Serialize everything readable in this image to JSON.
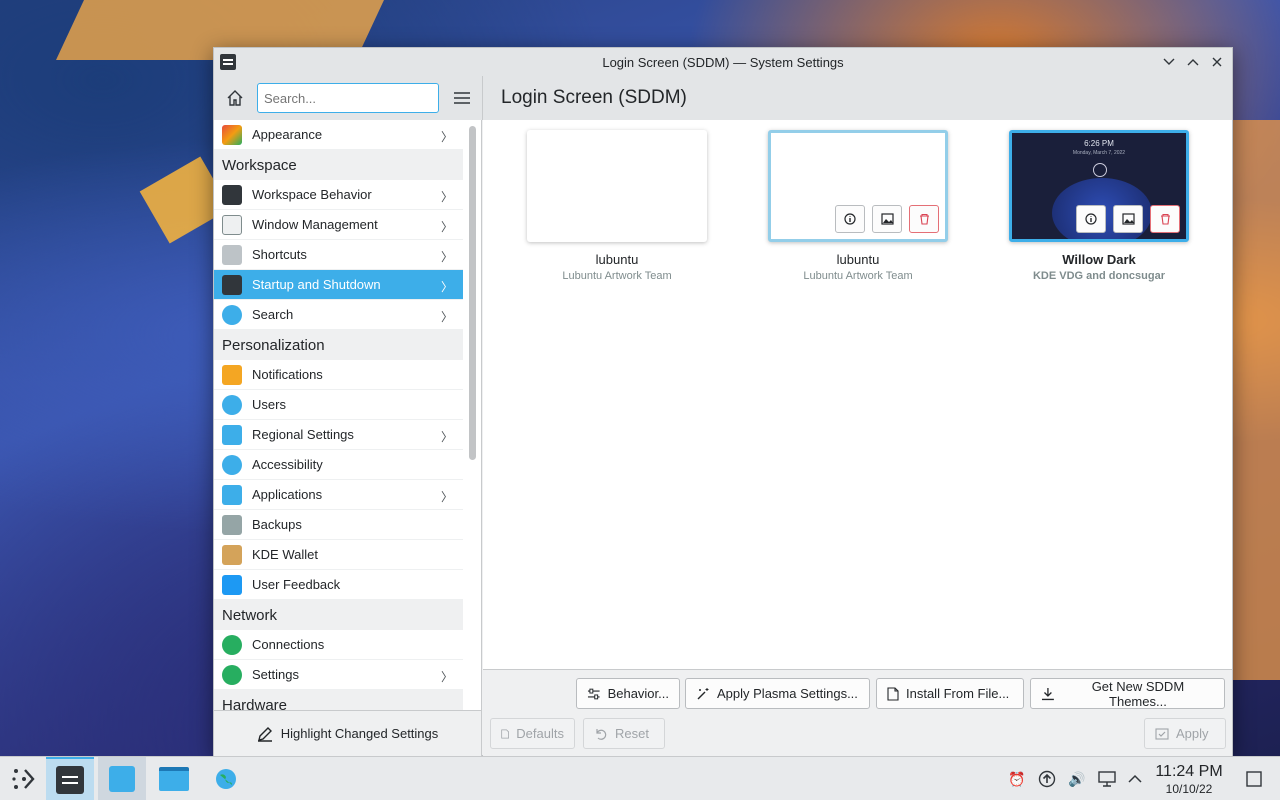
{
  "window": {
    "title": "Login Screen (SDDM) — System Settings"
  },
  "search": {
    "placeholder": "Search..."
  },
  "page_title": "Login Screen (SDDM)",
  "sidebar": {
    "top_item": {
      "label": "Appearance",
      "icon": "appearance-icon"
    },
    "sections": [
      {
        "title": "Workspace",
        "items": [
          {
            "label": "Workspace Behavior",
            "icon": "workspace-behavior-icon",
            "chevron": true
          },
          {
            "label": "Window Management",
            "icon": "window-management-icon",
            "chevron": true
          },
          {
            "label": "Shortcuts",
            "icon": "keyboard-icon",
            "chevron": true
          },
          {
            "label": "Startup and Shutdown",
            "icon": "startup-icon",
            "chevron": true,
            "selected": true
          },
          {
            "label": "Search",
            "icon": "search-icon",
            "chevron": true
          }
        ]
      },
      {
        "title": "Personalization",
        "items": [
          {
            "label": "Notifications",
            "icon": "bell-icon"
          },
          {
            "label": "Users",
            "icon": "users-icon"
          },
          {
            "label": "Regional Settings",
            "icon": "regional-icon",
            "chevron": true
          },
          {
            "label": "Accessibility",
            "icon": "accessibility-icon"
          },
          {
            "label": "Applications",
            "icon": "applications-icon",
            "chevron": true
          },
          {
            "label": "Backups",
            "icon": "backups-icon"
          },
          {
            "label": "KDE Wallet",
            "icon": "wallet-icon"
          },
          {
            "label": "User Feedback",
            "icon": "feedback-icon"
          }
        ]
      },
      {
        "title": "Network",
        "items": [
          {
            "label": "Connections",
            "icon": "globe-icon"
          },
          {
            "label": "Settings",
            "icon": "network-settings-icon",
            "chevron": true
          }
        ]
      },
      {
        "title": "Hardware",
        "items": []
      }
    ],
    "footer_label": "Highlight Changed Settings"
  },
  "themes": [
    {
      "name": "lubuntu",
      "author": "Lubuntu Artwork Team",
      "state": "normal"
    },
    {
      "name": "lubuntu",
      "author": "Lubuntu Artwork Team",
      "state": "hover"
    },
    {
      "name": "Willow Dark",
      "author": "KDE VDG and doncsugar",
      "state": "current",
      "preview_time": "6:26 PM",
      "preview_date": "Monday, March 7, 2022"
    }
  ],
  "footer": {
    "behavior": "Behavior...",
    "apply_plasma": "Apply Plasma Settings...",
    "install_file": "Install From File...",
    "get_new": "Get New SDDM Themes...",
    "defaults": "Defaults",
    "reset": "Reset",
    "apply": "Apply"
  },
  "taskbar": {
    "time": "11:24 PM",
    "date": "10/10/22"
  },
  "colors": {
    "accent": "#3daee9",
    "window_bg": "#eff0f1",
    "selected_text": "#ffffff"
  }
}
